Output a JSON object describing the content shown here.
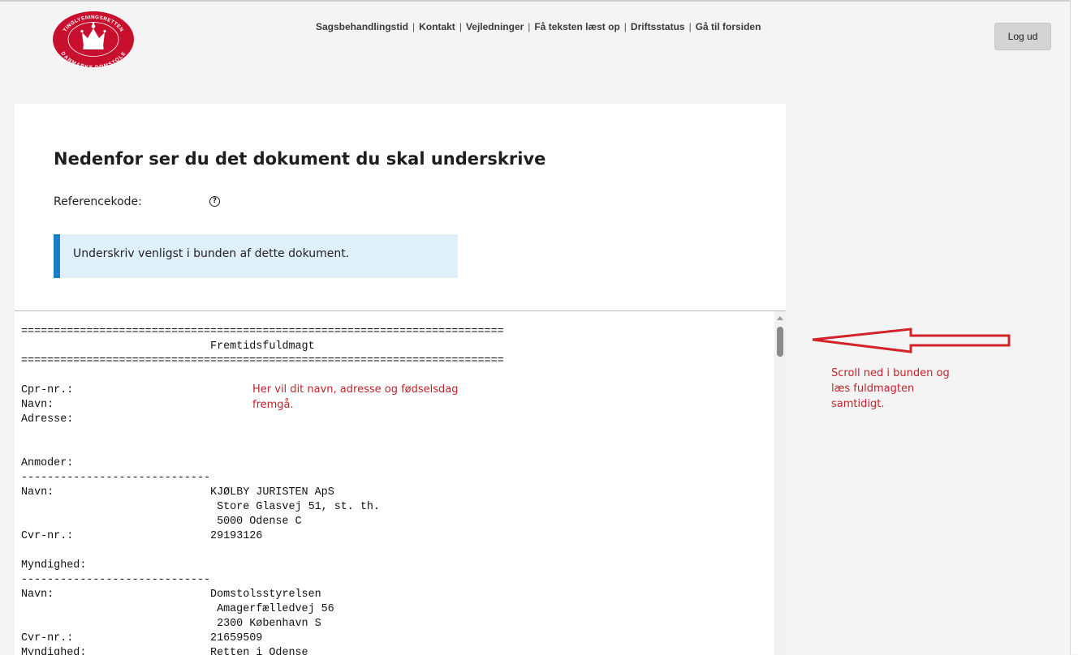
{
  "header": {
    "logo": {
      "icon": "crown-seal-icon",
      "text": "TINGLYSNINGSRETTEN · DANMARKS DOMSTOLE",
      "color": "#c8102e"
    },
    "nav": [
      {
        "label": "Sagsbehandlingstid"
      },
      {
        "label": "Kontakt"
      },
      {
        "label": "Vejledninger"
      },
      {
        "label": "Få teksten læst op"
      },
      {
        "label": "Driftsstatus"
      },
      {
        "label": "Gå til forsiden"
      }
    ],
    "nav_separator": "|",
    "logout_label": "Log ud"
  },
  "main": {
    "title": "Nedenfor ser du det dokument du skal underskrive",
    "reference_label": "Referencekode:",
    "reference_value": "",
    "help_symbol": "?",
    "info_text": "Underskriv venligst i bunden af dette dokument."
  },
  "document": {
    "rule": "==========================================================================",
    "doc_title": "Fremtidsfuldmagt",
    "dash_rule": "-----------------------------",
    "person_fields": [
      "Cpr-nr.:",
      "Navn:",
      "Adresse:"
    ],
    "requester": {
      "heading": "Anmoder:",
      "name_label": "Navn:",
      "name": "KJØLBY JURISTEN ApS",
      "address_line1": "Store Glasvej 51, st. th.",
      "address_line2": "5000 Odense C",
      "cvr_label": "Cvr-nr.:",
      "cvr": "29193126"
    },
    "authority": {
      "heading": "Myndighed:",
      "name_label": "Navn:",
      "name": "Domstolsstyrelsen",
      "address_line1": "Amagerfælledvej 56",
      "address_line2": "2300 København S",
      "cvr_label": "Cvr-nr.:",
      "cvr": "21659509",
      "sub_label": "Myndighed:",
      "sub_value": "Retten i Odense"
    }
  },
  "annotations": {
    "inline_note_line1": "Her vil dit navn, adresse og fødselsdag",
    "inline_note_line2": "fremgå.",
    "side_note_line1": "Scroll ned i bunden og",
    "side_note_line2": "læs fuldmagten",
    "side_note_line3": "samtidigt.",
    "arrow_icon": "left-arrow-icon",
    "color": "#c0242a"
  }
}
